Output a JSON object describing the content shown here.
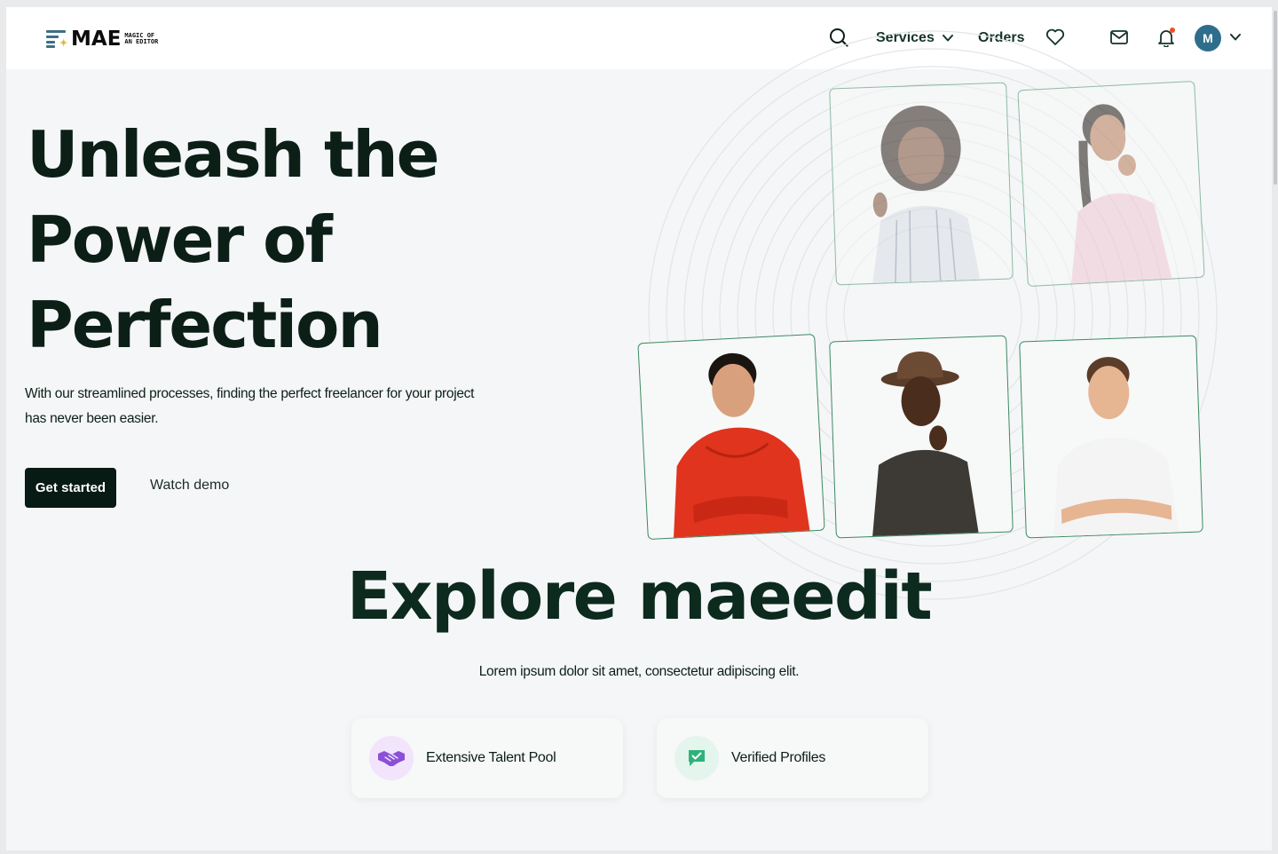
{
  "header": {
    "logo": {
      "word": "MAE",
      "sub_line1": "MAGIC OF",
      "sub_line2": "AN EDITOR"
    },
    "nav": {
      "services_label": "Services",
      "orders_label": "Orders",
      "avatar_initial": "M"
    },
    "icons": [
      "search-icon",
      "chevron-down-icon",
      "heart-icon",
      "mail-icon",
      "bell-icon",
      "chevron-down-icon"
    ],
    "notification_color": "#f04e23"
  },
  "hero": {
    "title_lines": [
      "Unleash the",
      "Power of",
      "Perfection"
    ],
    "subtitle": "With our streamlined processes, finding the perfect freelancer for your project has never been easier.",
    "primary_cta": "Get started",
    "secondary_cta": "Watch demo"
  },
  "photos": [
    {
      "label": "freelancer-woman-curly-hair",
      "faded": true
    },
    {
      "label": "freelancer-woman-pink-top",
      "faded": true
    },
    {
      "label": "freelancer-man-red-hoodie",
      "faded": false
    },
    {
      "label": "freelancer-man-hat",
      "faded": false
    },
    {
      "label": "freelancer-man-white-tee",
      "faded": false
    }
  ],
  "explore": {
    "title": "Explore maeedit",
    "subtitle": "Lorem ipsum dolor sit amet, consectetur adipiscing elit.",
    "features": [
      {
        "label": "Extensive Talent Pool",
        "icon": "handshake-icon",
        "color": "#8b4fd8"
      },
      {
        "label": "Verified Profiles",
        "icon": "verified-chat-icon",
        "color": "#2db37a"
      }
    ]
  },
  "colors": {
    "primary": "#071a14",
    "accent_green": "#3c8a63",
    "avatar_bg": "#2f6d8c"
  }
}
